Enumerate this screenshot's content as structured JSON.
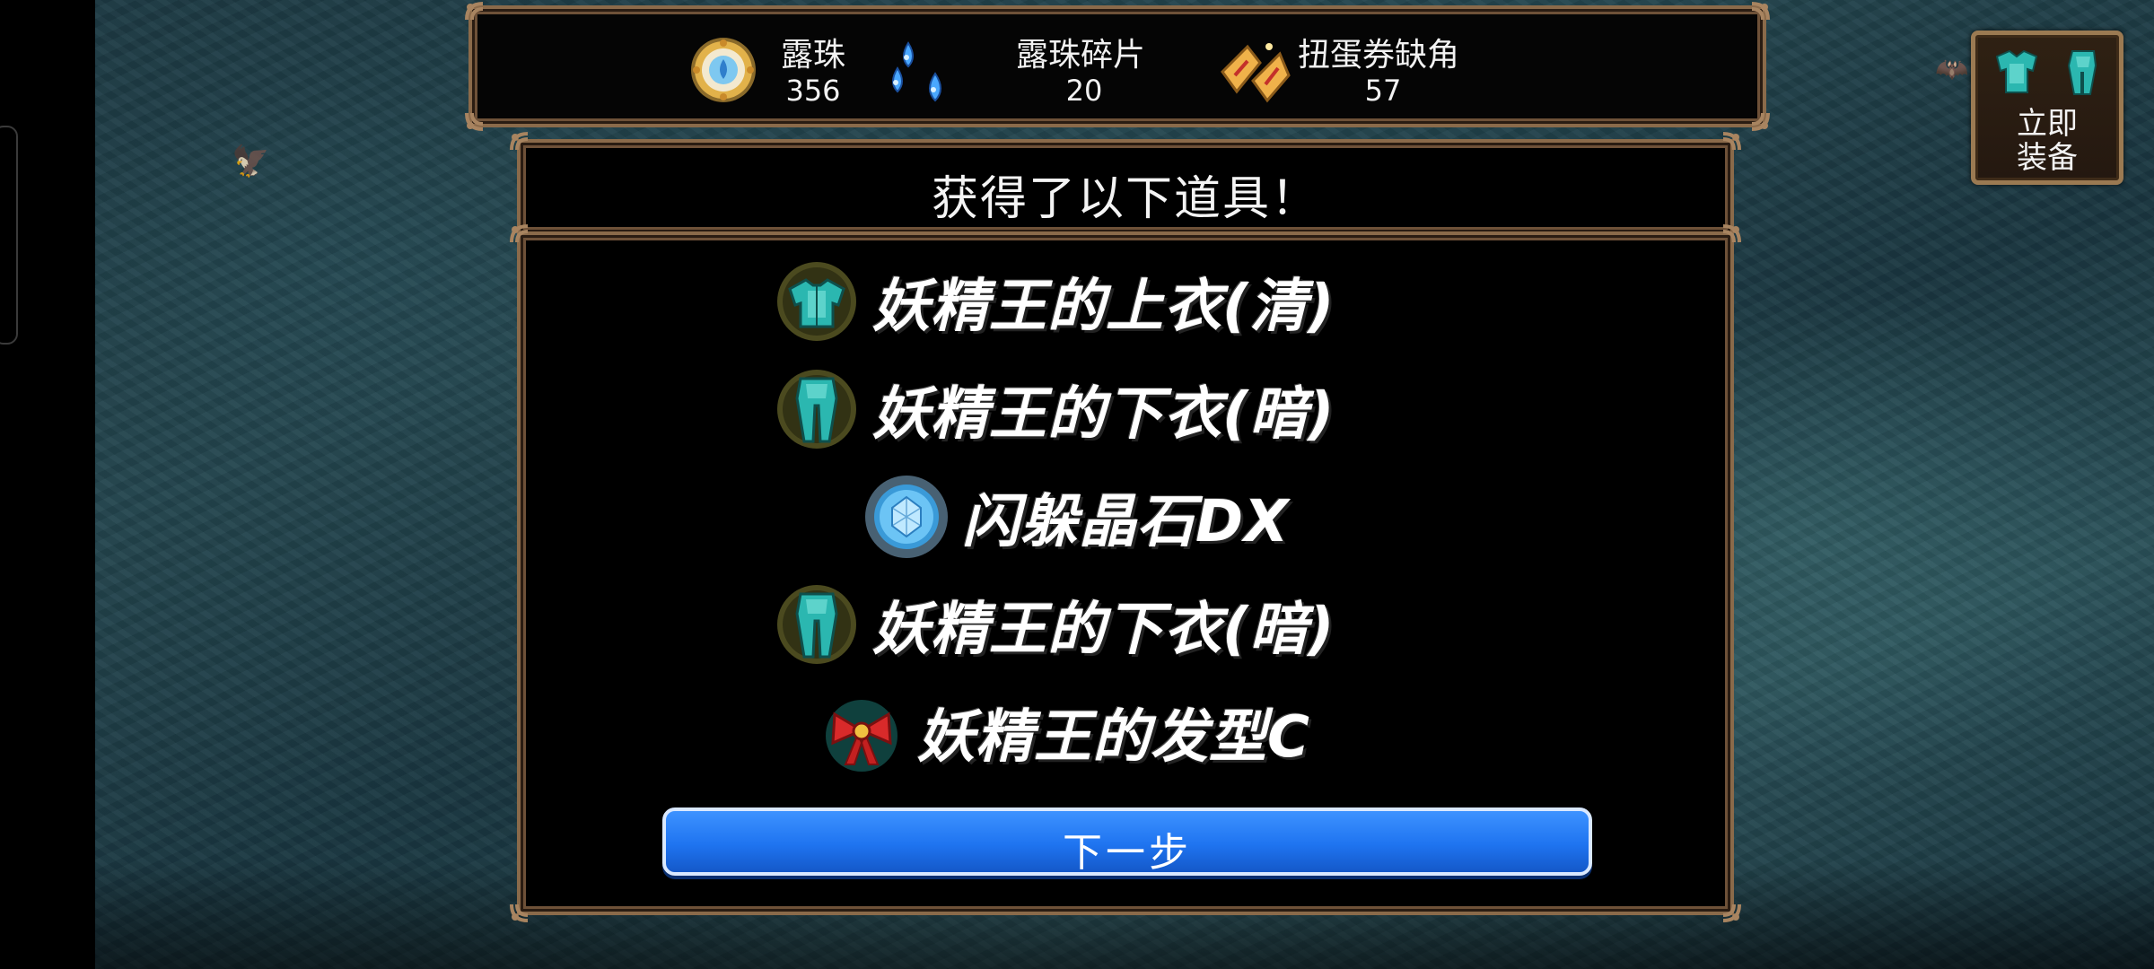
{
  "currencies": [
    {
      "name": "露珠",
      "value": "356",
      "icon": "dew-pearl-icon"
    },
    {
      "name": "露珠碎片",
      "value": "20",
      "icon": "dew-shard-icon"
    },
    {
      "name": "扭蛋券缺角",
      "value": "57",
      "icon": "gacha-ticket-fragment-icon"
    }
  ],
  "equip_now": {
    "label": "立即\n装备",
    "icon": "armor-set-icon"
  },
  "result": {
    "title": "获得了以下道具！",
    "items": [
      {
        "name": "妖精王的上衣(清)",
        "icon": "fairy-king-top-icon"
      },
      {
        "name": "妖精王的下衣(暗)",
        "icon": "fairy-king-bottom-icon"
      },
      {
        "name": "闪躲晶石DX",
        "icon": "evasion-crystal-icon"
      },
      {
        "name": "妖精王的下衣(暗)",
        "icon": "fairy-king-bottom-icon"
      },
      {
        "name": "妖精王的发型C",
        "icon": "fairy-king-hairstyle-icon"
      }
    ],
    "next_label": "下一步"
  },
  "colors": {
    "frame_bronze": "#8a6a4a",
    "button_blue": "#1f74f0",
    "item_glow": "#d8d35a",
    "armor_teal": "#2bb7b0"
  }
}
